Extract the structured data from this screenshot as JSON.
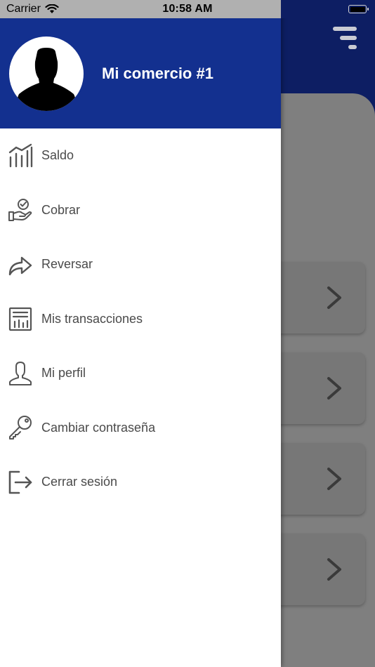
{
  "status_bar": {
    "carrier": "Carrier",
    "time": "10:58 AM"
  },
  "drawer": {
    "store_name": "Mi comercio #1",
    "menu_items": [
      {
        "label": "Saldo",
        "icon": "bar-chart-icon"
      },
      {
        "label": "Cobrar",
        "icon": "hand-check-icon"
      },
      {
        "label": "Reversar",
        "icon": "forward-arrow-icon"
      },
      {
        "label": "Mis transacciones",
        "icon": "receipt-icon"
      },
      {
        "label": "Mi perfil",
        "icon": "user-icon"
      },
      {
        "label": "Cambiar contraseña",
        "icon": "key-icon"
      },
      {
        "label": "Cerrar sesión",
        "icon": "logout-icon"
      }
    ]
  },
  "colors": {
    "drawer_header": "#13308f",
    "background_header": "#0d1e63",
    "menu_text": "#4a4a4a",
    "icon_stroke": "#555555"
  }
}
